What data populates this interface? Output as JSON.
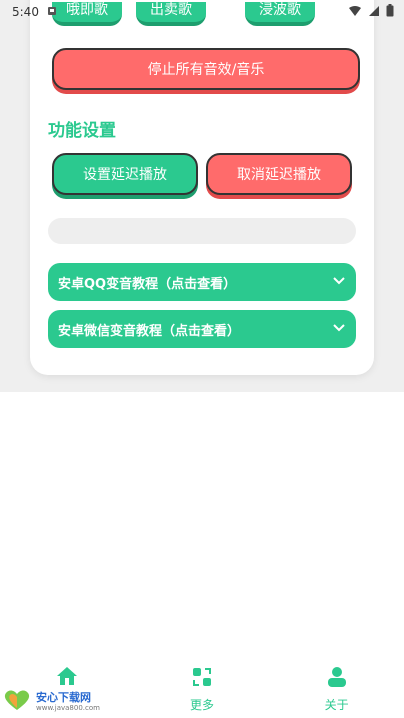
{
  "status_bar": {
    "time": "5:40"
  },
  "top_chips": [
    "哦即歌",
    "出卖歌",
    "浸波歌"
  ],
  "stop_all_label": "停止所有音效/音乐",
  "section_title": "功能设置",
  "delay_set_label": "设置延迟播放",
  "delay_cancel_label": "取消延迟播放",
  "accordions": [
    {
      "label": "安卓QQ变音教程（点击查看）"
    },
    {
      "label": "安卓微信变音教程（点击查看）"
    }
  ],
  "nav": {
    "more_label": "更多",
    "about_label": "关于"
  },
  "watermark": {
    "title": "安心下载网",
    "sub": "www.java800.com"
  },
  "colors": {
    "accent": "#2bc98f",
    "danger": "#ff6b6b"
  }
}
